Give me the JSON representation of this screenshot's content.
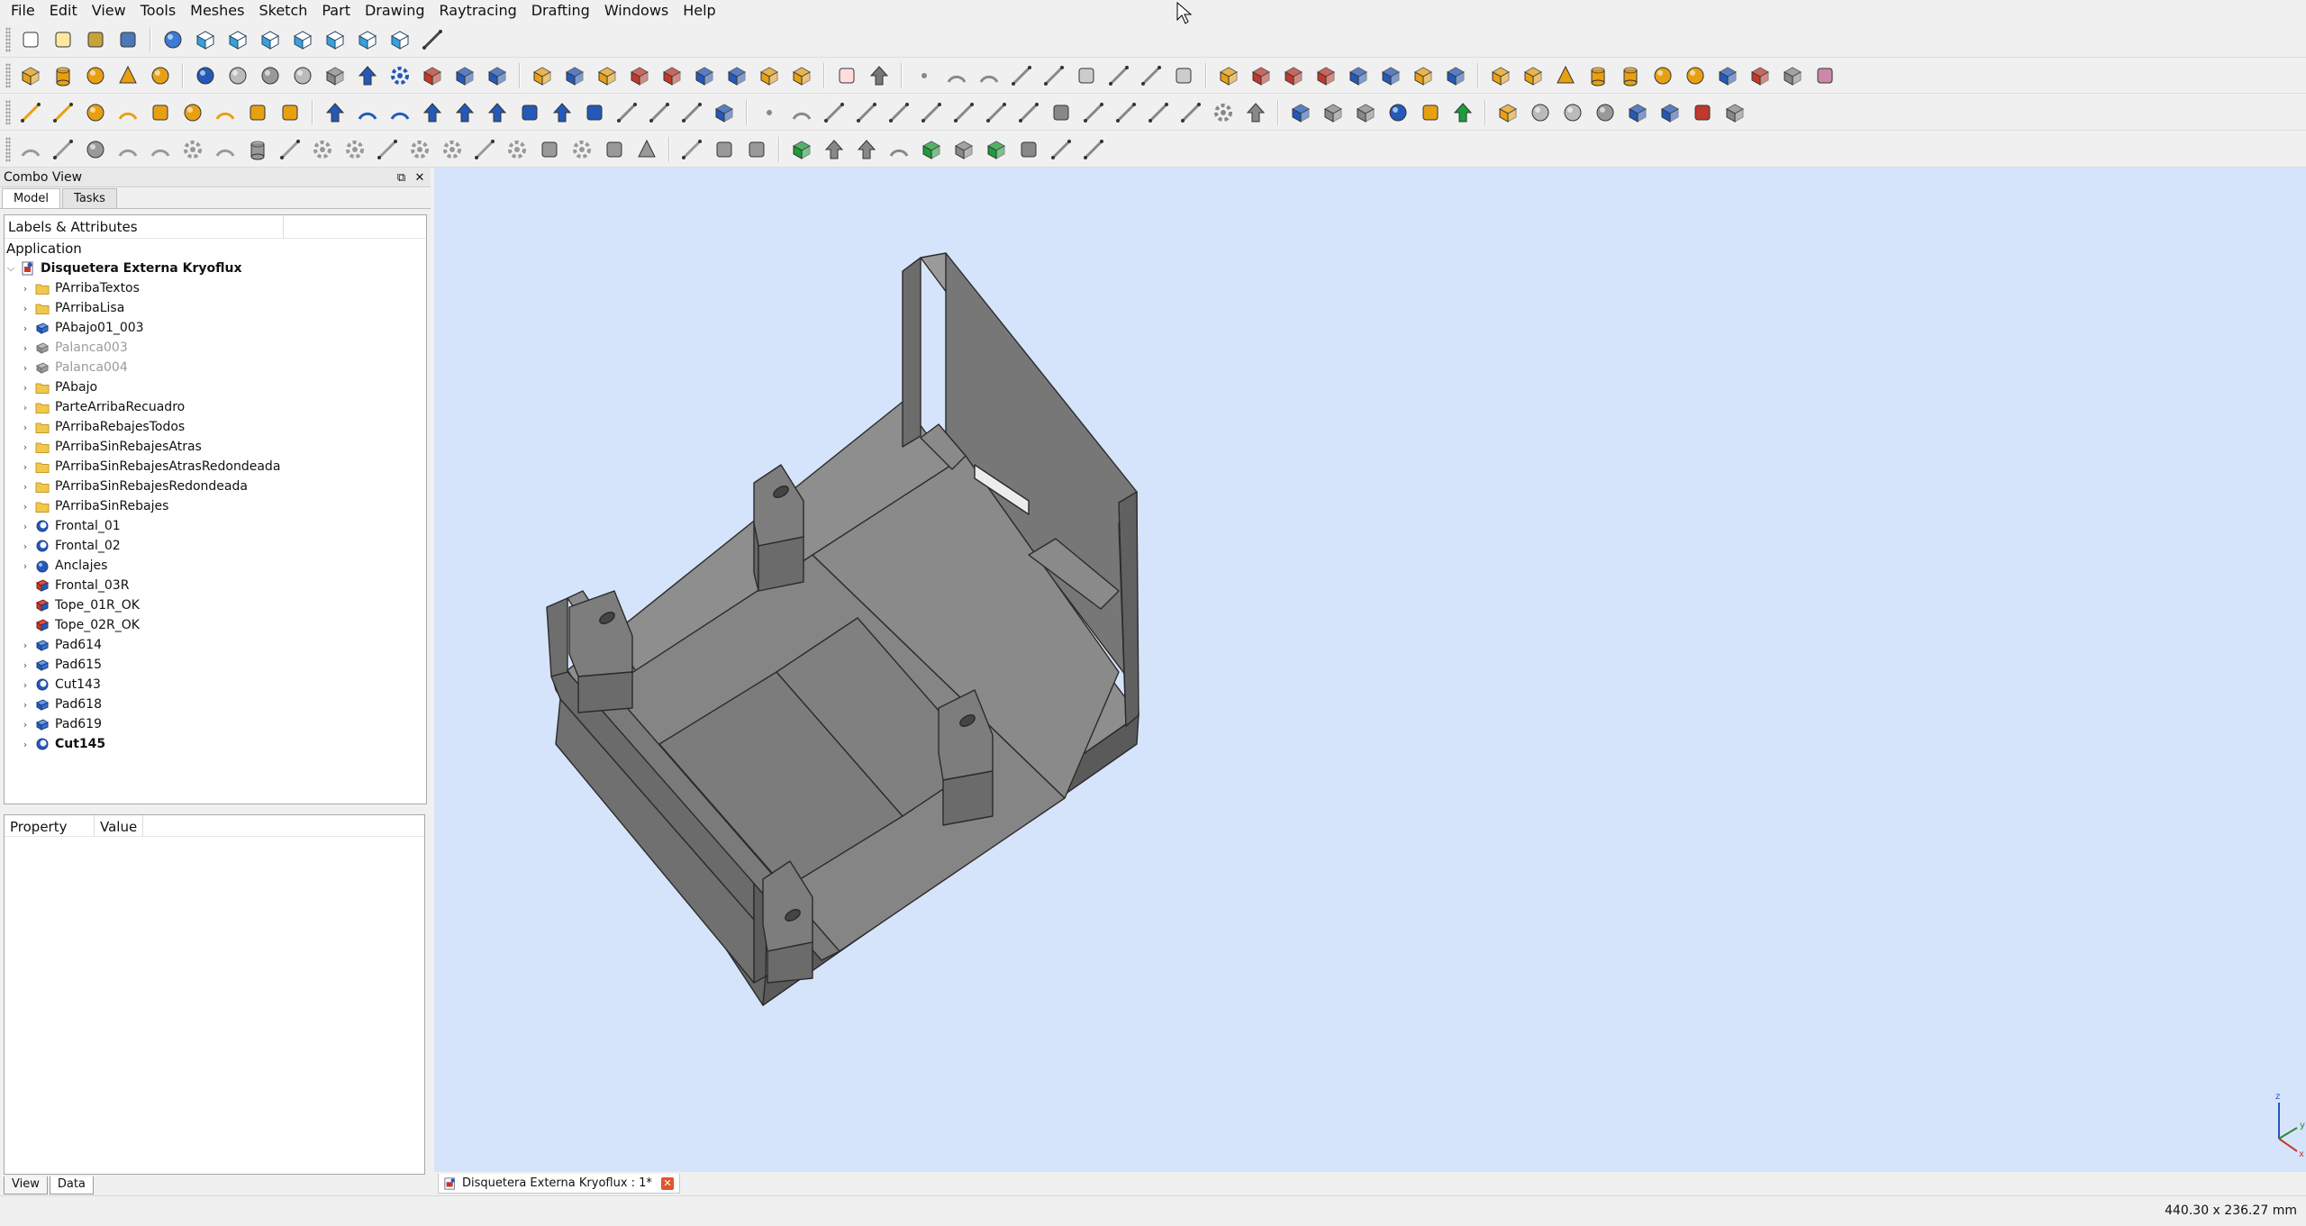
{
  "menubar": {
    "items": [
      "File",
      "Edit",
      "View",
      "Tools",
      "Meshes",
      "Sketch",
      "Part",
      "Drawing",
      "Raytracing",
      "Drafting",
      "Windows",
      "Help"
    ]
  },
  "colors": {
    "view_background": "#d6e4fb",
    "model_face_light": "#8c8c8c",
    "model_face_mid": "#7a7a7a",
    "model_face_dark": "#5e5e5e",
    "accent_orange": "#e8a013",
    "accent_blue": "#2459b8",
    "close_tab": "#e0552b"
  },
  "combo_view": {
    "title": "Combo View",
    "tabs": [
      "Model",
      "Tasks"
    ],
    "tree_header": "Labels & Attributes",
    "app_label": "Application",
    "document": "Disquetera Externa Kryoflux",
    "items": [
      {
        "label": "PArribaTextos",
        "icon": "folder-icon",
        "expand": true
      },
      {
        "label": "PArribaLisa",
        "icon": "folder-icon",
        "expand": true
      },
      {
        "label": "PAbajo01_003",
        "icon": "pad-icon",
        "expand": true
      },
      {
        "label": "Palanca003",
        "icon": "pad-gray-icon",
        "expand": true,
        "hidden": true
      },
      {
        "label": "Palanca004",
        "icon": "pad-gray-icon",
        "expand": true,
        "hidden": true
      },
      {
        "label": "PAbajo",
        "icon": "folder-icon",
        "expand": true
      },
      {
        "label": "ParteArribaRecuadro",
        "icon": "folder-icon",
        "expand": true
      },
      {
        "label": "PArribaRebajesTodos",
        "icon": "folder-icon",
        "expand": true
      },
      {
        "label": "PArribaSinRebajesAtras",
        "icon": "folder-icon",
        "expand": true
      },
      {
        "label": "PArribaSinRebajesAtrasRedondeada",
        "icon": "folder-icon",
        "expand": true
      },
      {
        "label": "PArribaSinRebajesRedondeada",
        "icon": "folder-icon",
        "expand": true
      },
      {
        "label": "PArribaSinRebajes",
        "icon": "folder-icon",
        "expand": true
      },
      {
        "label": "Frontal_01",
        "icon": "cut-icon",
        "expand": true
      },
      {
        "label": "Frontal_02",
        "icon": "cut-icon",
        "expand": true
      },
      {
        "label": "Anclajes",
        "icon": "fusion-icon",
        "expand": true
      },
      {
        "label": "Frontal_03R",
        "icon": "solid-icon",
        "expand": false
      },
      {
        "label": "Tope_01R_OK",
        "icon": "solid-icon",
        "expand": false
      },
      {
        "label": "Tope_02R_OK",
        "icon": "solid-icon",
        "expand": false
      },
      {
        "label": "Pad614",
        "icon": "pad-icon",
        "expand": true
      },
      {
        "label": "Pad615",
        "icon": "pad-icon",
        "expand": true
      },
      {
        "label": "Cut143",
        "icon": "cut-icon",
        "expand": true
      },
      {
        "label": "Pad618",
        "icon": "pad-icon",
        "expand": true
      },
      {
        "label": "Pad619",
        "icon": "pad-icon",
        "expand": true
      },
      {
        "label": "Cut145",
        "icon": "cut-icon",
        "expand": true,
        "bold": true
      }
    ],
    "property_header": "Property",
    "value_header": "Value",
    "bottom_tabs": [
      "View",
      "Data"
    ]
  },
  "document_tab": {
    "label": "Disquetera Externa Kryoflux : 1*"
  },
  "status": {
    "dimensions": "440.30 x 236.27 mm"
  },
  "axis": {
    "x": "x",
    "y": "y",
    "z": "z"
  }
}
